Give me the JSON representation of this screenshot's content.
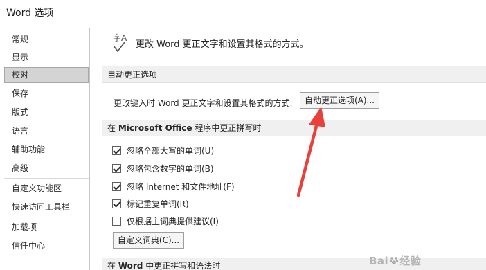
{
  "window": {
    "title": "Word 选项"
  },
  "sidebar": {
    "items": [
      {
        "label": "常规"
      },
      {
        "label": "显示"
      },
      {
        "label": "校对",
        "selected": true
      },
      {
        "label": "保存"
      },
      {
        "label": "版式"
      },
      {
        "label": "语言"
      },
      {
        "label": "辅助功能"
      },
      {
        "label": "高级"
      },
      {
        "label": "自定义功能区"
      },
      {
        "label": "快速访问工具栏"
      },
      {
        "label": "加载项"
      },
      {
        "label": "信任中心"
      }
    ]
  },
  "header": {
    "icon": "proofing-icon",
    "icon_glyph": "字A",
    "description": "更改 Word 更正文字和设置其格式的方式。"
  },
  "autocorrect": {
    "section_title": "自动更正选项",
    "row_label": "更改键入时 Word 更正文字和设置其格式的方式:",
    "button_label": "自动更正选项(A)..."
  },
  "office_spelling": {
    "section_prefix": "在 ",
    "section_bold": "Microsoft Office",
    "section_suffix": " 程序中更正拼写时",
    "options": [
      {
        "label": "忽略全部大写的单词(U)",
        "checked": true
      },
      {
        "label": "忽略包含数字的单词(B)",
        "checked": true
      },
      {
        "label": "忽略 Internet 和文件地址(F)",
        "checked": true
      },
      {
        "label": "标记重复单词(R)",
        "checked": true
      },
      {
        "label": "仅根据主词典提供建议(I)",
        "checked": false
      }
    ],
    "custom_dict_button": "自定义词典(C)..."
  },
  "word_spelling": {
    "section_prefix": "在 ",
    "section_bold": "Word",
    "section_suffix": " 中更正拼写和语法时"
  },
  "annotation": {
    "arrow_color": "#e8403a"
  },
  "watermark": {
    "text_a": "Bai",
    "text_b": "经验"
  },
  "colors": {
    "selected_bg": "#d4d4d4",
    "section_bg": "#f0f0f0"
  }
}
